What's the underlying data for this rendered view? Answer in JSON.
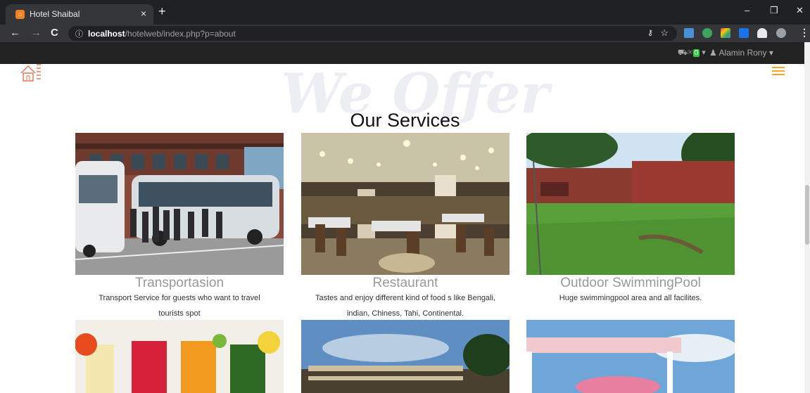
{
  "browser": {
    "tab_title": "Hotel Shaibal",
    "tab_close": "×",
    "new_tab": "+",
    "url_host": "localhost",
    "url_path": "/hotelweb/index.php?p=about",
    "window_controls": [
      "–",
      "❐",
      "✕"
    ]
  },
  "site": {
    "cart_count": "0",
    "user_name": "Alamin Rony",
    "background_word": "We Offer",
    "section_title": "Our Services"
  },
  "services": [
    {
      "name": "Transportasion",
      "desc_line1": "Transport Service for guests who want to travel",
      "desc_line2": "tourists spot"
    },
    {
      "name": "Restaurant",
      "desc_line1": "Tastes and enjoy different kind of food s like Bengali,",
      "desc_line2": "indian, Chiness, Tahi, Continental."
    },
    {
      "name": "Outdoor SwimmingPool",
      "desc_line1": "Huge swimmingpool area and all facilites.",
      "desc_line2": ""
    }
  ],
  "colors": {
    "accent": "#f5a623",
    "chrome_dark": "#202124",
    "chrome_mid": "#35363a",
    "site_bar": "#222222",
    "cart_badge": "#2ecc40"
  },
  "icons": [
    "back-icon",
    "forward-icon",
    "reload-icon",
    "info-icon",
    "key-icon",
    "star-icon",
    "cart-icon",
    "mail-icon",
    "user-icon",
    "hamburger-icon"
  ]
}
